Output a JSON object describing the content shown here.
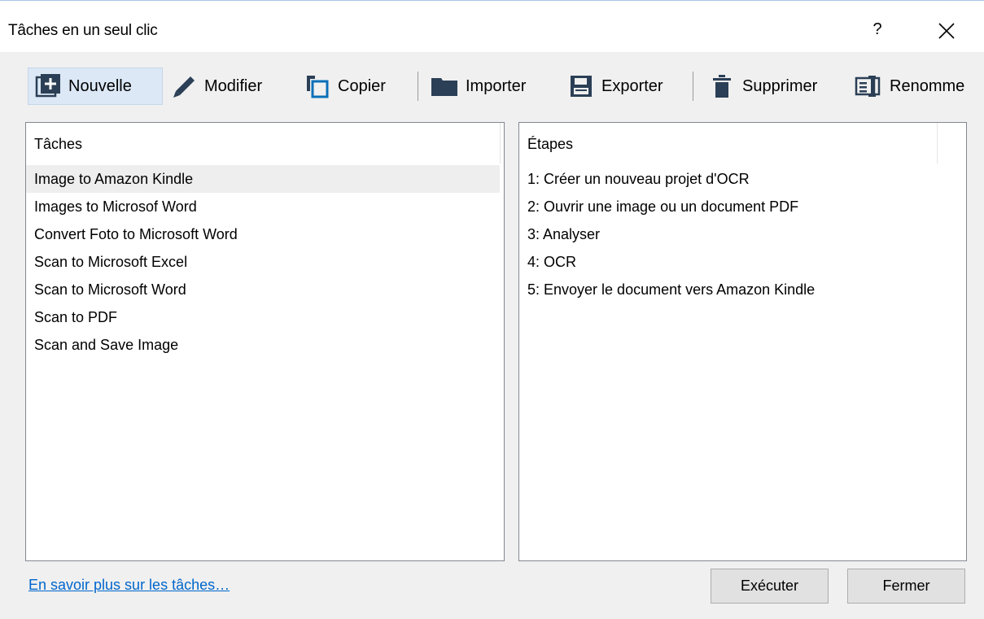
{
  "window": {
    "title": "Tâches en un seul clic",
    "help_label": "?",
    "close_icon": "close-icon"
  },
  "toolbar": {
    "buttons": [
      {
        "label": "Nouvelle",
        "icon": "new-task-icon",
        "selected": true
      },
      {
        "label": "Modifier",
        "icon": "pencil-icon"
      },
      {
        "label": "Copier",
        "icon": "copy-icon"
      },
      {
        "label": "Importer",
        "icon": "folder-icon"
      },
      {
        "label": "Exporter",
        "icon": "save-icon"
      },
      {
        "label": "Supprimer",
        "icon": "trash-icon"
      },
      {
        "label": "Renomme",
        "icon": "rename-icon"
      }
    ]
  },
  "tasks_panel": {
    "header": "Tâches",
    "items": [
      "Image to Amazon Kindle",
      "Images to Microsof Word",
      "Convert Foto to Microsoft Word",
      "Scan to Microsoft Excel",
      "Scan to Microsoft Word",
      "Scan to PDF",
      "Scan and Save Image"
    ],
    "selected_index": 0
  },
  "steps_panel": {
    "header": "Étapes",
    "items": [
      "1: Créer un nouveau projet d'OCR",
      "2: Ouvrir une image ou un document PDF",
      "3: Analyser",
      "4: OCR",
      "5: Envoyer le document vers Amazon Kindle"
    ]
  },
  "footer": {
    "learn_more_link": "En savoir plus sur les tâches…",
    "execute_label": "Exécuter",
    "close_label": "Fermer"
  },
  "colors": {
    "accent": "#0066cc",
    "icon": "#2b3f56",
    "selected_toolbar_bg": "#dce8f6",
    "selected_row_bg": "#eeeeee"
  }
}
